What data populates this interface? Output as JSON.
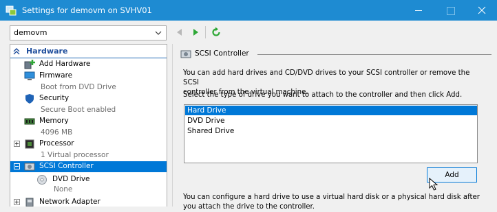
{
  "window": {
    "title": "Settings for demovm on SVHV01"
  },
  "vm_selector": {
    "value": "demovm"
  },
  "tree": {
    "header": "Hardware",
    "items": [
      {
        "label": "Add Hardware",
        "sub": ""
      },
      {
        "label": "Firmware",
        "sub": "Boot from DVD Drive"
      },
      {
        "label": "Security",
        "sub": "Secure Boot enabled"
      },
      {
        "label": "Memory",
        "sub": "4096 MB"
      },
      {
        "label": "Processor",
        "sub": "1 Virtual processor"
      },
      {
        "label": "SCSI Controller",
        "sub": ""
      },
      {
        "label": "DVD Drive",
        "sub": "None"
      },
      {
        "label": "Network Adapter",
        "sub": ""
      }
    ]
  },
  "panel": {
    "title": "SCSI Controller",
    "intro_line1": "You can add hard drives and CD/DVD drives to your SCSI controller or remove the SCSI",
    "intro_line2": "controller from the virtual machine.",
    "select_prompt": "Select the type of drive you want to attach to the controller and then click Add.",
    "drive_types": [
      "Hard Drive",
      "DVD Drive",
      "Shared Drive"
    ],
    "selected_drive": "Hard Drive",
    "add_label": "Add",
    "footer_line1": "You can configure a hard drive to use a virtual hard disk or a physical hard disk after",
    "footer_line2": "you attach the drive to the controller."
  },
  "colors": {
    "titlebar": "#1e8bd2",
    "selection": "#0078d7",
    "tree_header": "#1f4e9c"
  },
  "icons": {
    "window": "hyperv-settings-icon",
    "back": "back-arrow-icon",
    "forward": "forward-arrow-icon",
    "refresh": "refresh-icon"
  }
}
